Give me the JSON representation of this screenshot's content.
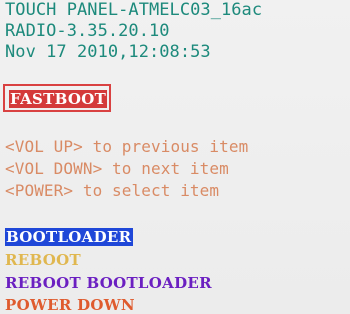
{
  "header": {
    "touch_panel": "TOUCH PANEL-ATMELC03_16ac",
    "radio": "RADIO-3.35.20.10",
    "build_date": "Nov 17 2010,12:08:53"
  },
  "mode": {
    "label": "FASTBOOT"
  },
  "instructions": [
    "<VOL UP> to previous item",
    "<VOL DOWN> to next item",
    "<POWER> to select item"
  ],
  "menu": {
    "items": [
      "BOOTLOADER",
      "REBOOT",
      "REBOOT BOOTLOADER",
      "POWER DOWN"
    ],
    "selected": "BOOTLOADER"
  },
  "colors": {
    "header_text": "#1d8a7c",
    "fastboot_box": "#d94141",
    "fastboot_fill": "#d43a3a",
    "instruction_text": "#d98b65",
    "selected_fill": "#1f47d8",
    "reboot_text": "#e0b74f",
    "reboot_bootloader_text": "#6b1fc1",
    "power_down_text": "#df5b2e"
  }
}
